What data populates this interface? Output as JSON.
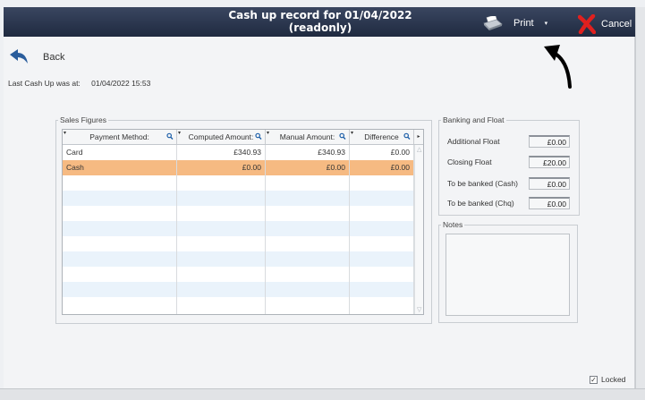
{
  "window": {
    "title_line1": "Cash up record for 01/04/2022",
    "title_line2": "(readonly)"
  },
  "toolbar": {
    "print_label": "Print",
    "print_dropdown": "▾",
    "cancel_label": "Cancel"
  },
  "nav": {
    "back_label": "Back"
  },
  "last_cash_up": {
    "label": "Last Cash Up was at:",
    "value": "01/04/2022 15:53"
  },
  "sales_figures": {
    "legend": "Sales Figures",
    "columns": [
      {
        "label": "Payment Method:"
      },
      {
        "label": "Computed Amount:"
      },
      {
        "label": "Manual Amount:"
      },
      {
        "label": "Difference"
      }
    ],
    "rows": [
      {
        "method": "Card",
        "computed": "£340.93",
        "manual": "£340.93",
        "difference": "£0.00"
      },
      {
        "method": "Cash",
        "computed": "£0.00",
        "manual": "£0.00",
        "difference": "£0.00"
      }
    ]
  },
  "banking": {
    "legend": "Banking and Float",
    "fields": [
      {
        "label": "Additional Float",
        "value": "£0.00"
      },
      {
        "label": "Closing  Float",
        "value": "£20.00"
      },
      {
        "label": "To be banked (Cash)",
        "value": "£0.00"
      },
      {
        "label": "To be banked (Chq)",
        "value": "£0.00"
      }
    ]
  },
  "notes": {
    "legend": "Notes",
    "value": ""
  },
  "locked": {
    "label": "Locked",
    "checked": true
  },
  "colors": {
    "titlebar": "#27324b",
    "selected_row": "#f6ba82",
    "alt_row": "#eaf3fb",
    "cancel_icon": "#e0201e",
    "back_icon": "#2a5d9c"
  },
  "icons": {
    "print": "printer-icon",
    "cancel": "red-x-icon",
    "back": "back-arrow-icon",
    "annotation": "curved-arrow-icon",
    "search": "magnifier-icon"
  }
}
